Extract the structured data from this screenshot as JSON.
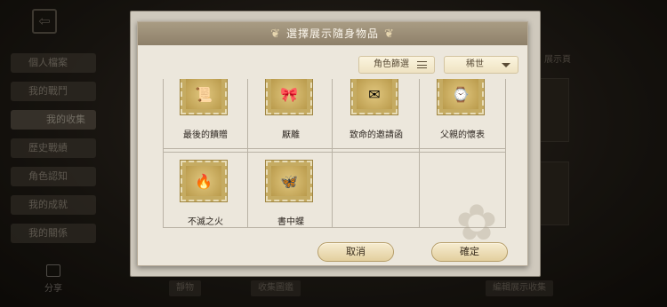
{
  "background": {
    "nav_items": [
      "個人檔案",
      "我的戰鬥",
      "我的收集",
      "歷史戰績",
      "角色認知",
      "我的成就",
      "我的關係"
    ],
    "active_index": 2,
    "share_label": "分享",
    "right_title": "展示頁",
    "bottom": {
      "left": "靜物",
      "middle": "收集圖鑑",
      "right": "編輯展示收集"
    }
  },
  "dialog": {
    "title": "選擇展示隨身物品",
    "filter_role": "角色篩選",
    "filter_rarity": "稀世",
    "items": [
      {
        "label": "最後的饋贈",
        "icon": "scroll-bandage-icon",
        "glyph": "📜"
      },
      {
        "label": "厭離",
        "icon": "bow-ribbon-icon",
        "glyph": "🎀"
      },
      {
        "label": "致命的邀請函",
        "icon": "winged-letter-icon",
        "glyph": "✉"
      },
      {
        "label": "父親的懷表",
        "icon": "pocket-watch-icon",
        "glyph": "⌚"
      },
      {
        "label": "不滅之火",
        "icon": "torch-icon",
        "glyph": "🔥"
      },
      {
        "label": "書中蝶",
        "icon": "butterfly-book-icon",
        "glyph": "🦋"
      }
    ],
    "cancel_label": "取消",
    "confirm_label": "確定"
  },
  "colors": {
    "header": "#9a8c74",
    "panel": "#ece7dc",
    "stamp": "#c5ab62",
    "button": "#ead8a8"
  }
}
